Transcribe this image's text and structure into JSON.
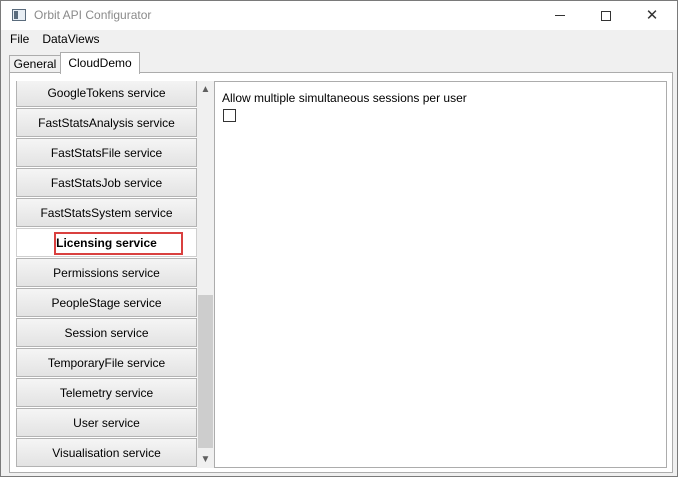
{
  "window": {
    "title": "Orbit API Configurator"
  },
  "menu": {
    "items": [
      "File",
      "DataViews"
    ]
  },
  "tabs": [
    {
      "label": "General",
      "selected": false
    },
    {
      "label": "CloudDemo",
      "selected": true
    }
  ],
  "services": [
    {
      "label": "GoogleTokens service"
    },
    {
      "label": "FastStatsAnalysis service"
    },
    {
      "label": "FastStatsFile service"
    },
    {
      "label": "FastStatsJob service"
    },
    {
      "label": "FastStatsSystem service"
    },
    {
      "label": "Licensing service",
      "selected": true
    },
    {
      "label": "Permissions service"
    },
    {
      "label": "PeopleStage service"
    },
    {
      "label": "Session service"
    },
    {
      "label": "TemporaryFile service"
    },
    {
      "label": "Telemetry service"
    },
    {
      "label": "User service"
    },
    {
      "label": "Visualisation service"
    }
  ],
  "settings": {
    "allow_multiple_sessions_label": "Allow multiple simultaneous sessions per user",
    "allow_multiple_sessions_checked": false
  },
  "colors": {
    "highlight": "#d9403f"
  },
  "icons": {
    "scroll_up": "chevron-up-icon",
    "scroll_down": "chevron-down-icon"
  }
}
